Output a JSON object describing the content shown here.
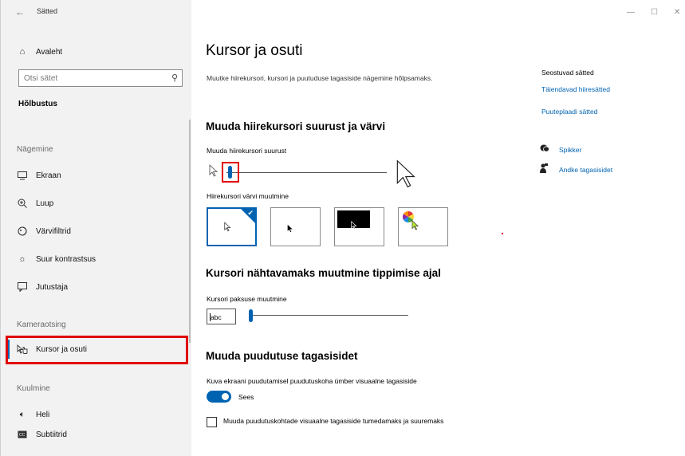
{
  "window": {
    "title": "Sätted",
    "back_glyph": "←",
    "minimize_glyph": "—",
    "maximize_glyph": "☐",
    "close_glyph": "✕"
  },
  "sidebar": {
    "home_label": "Avaleht",
    "search_placeholder": "Otsi sätet",
    "section_heading": "Hõlbustus",
    "groups": {
      "vision": "Nägemine",
      "interaction": "Kameraotsing",
      "hearing": "Kuulmine"
    },
    "items": [
      {
        "label": "Ekraan",
        "icon": "monitor-icon"
      },
      {
        "label": "Luup",
        "icon": "magnifier-icon"
      },
      {
        "label": "Värvifiltrid",
        "icon": "color-filter-icon"
      },
      {
        "label": "Suur kontrastsus",
        "icon": "contrast-icon"
      },
      {
        "label": "Jutustaja",
        "icon": "narrator-icon"
      },
      {
        "label": "Kursor ja osuti",
        "icon": "cursor-pointer-icon",
        "active": true
      },
      {
        "label": "Heli",
        "icon": "speaker-icon"
      },
      {
        "label": "Subtiitrid",
        "icon": "captions-icon"
      }
    ]
  },
  "main": {
    "title": "Kursor ja osuti",
    "description": "Muutke hiirekursori, kursori ja puutuduse tagasiside nägemine hõlpsamaks.",
    "pointer_section": {
      "title": "Muuda hiirekursori suurust ja värvi",
      "size_label": "Muuda hiirekursori suurust",
      "size_level": 0.0,
      "color_label": "Hiirekursori värvi muutmine",
      "color_options": [
        {
          "name": "white",
          "selected": true
        },
        {
          "name": "black",
          "selected": false
        },
        {
          "name": "inverted",
          "selected": false
        },
        {
          "name": "custom",
          "selected": false
        }
      ]
    },
    "cursor_section": {
      "title": "Kursori nähtavamaks muutmine tippimise ajal",
      "thickness_label": "Kursori paksuse muutmine",
      "preview_text": "abc",
      "thickness_level": 0.0
    },
    "touch_section": {
      "title": "Muuda puudutuse tagasisidet",
      "feedback_label": "Kuva ekraani puudutamisel puudutuskoha ümber visuaalne tagasiside",
      "toggle_state": "Sees",
      "toggle_on": true,
      "checkbox_label": "Muuda puudutuskohtade visuaalne tagasiside tumedamaks ja suuremaks",
      "checkbox_checked": false
    }
  },
  "related": {
    "title": "Seostuvad sätted",
    "links": [
      "Täiendavad hiiresätted",
      "Puuteplaadi sätted"
    ],
    "help": [
      {
        "label": "Spikker",
        "icon": "help-chat-icon"
      },
      {
        "label": "Andke tagasisidet",
        "icon": "feedback-icon"
      }
    ]
  },
  "colors": {
    "accent": "#0063b1",
    "highlight": "#e00000",
    "sidebar_bg": "#f2f2f2"
  }
}
